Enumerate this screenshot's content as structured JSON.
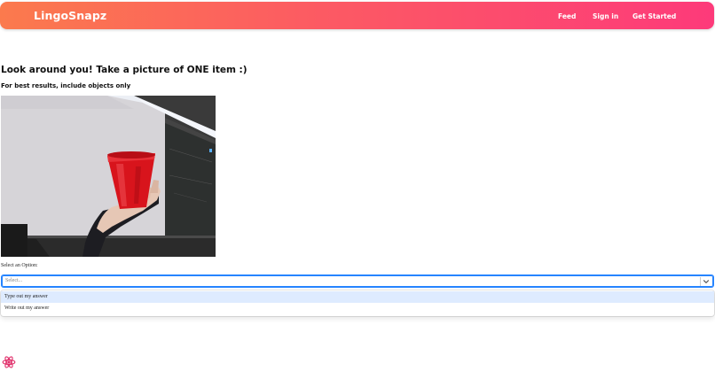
{
  "navbar": {
    "brand": "LingoSnapz",
    "links": [
      "Feed",
      "Sign in",
      "Get Started"
    ],
    "gradient": [
      "#fb7a4d",
      "#fd3a7a"
    ]
  },
  "main": {
    "heading": "Look around you! Take a picture of ONE item :)",
    "subheading": "For best results, include objects only",
    "camera_feed": {
      "icon": "camera-feed-image",
      "subject": "red cup"
    }
  },
  "select": {
    "label": "Select an Option:",
    "placeholder": "Select...",
    "options": [
      "Type out my answer",
      "Write out my answer"
    ],
    "focused_option_index": 0,
    "accent_color": "#2684ff"
  },
  "floating": {
    "icon": "react-devtools-icon",
    "color": "#e0306b"
  }
}
